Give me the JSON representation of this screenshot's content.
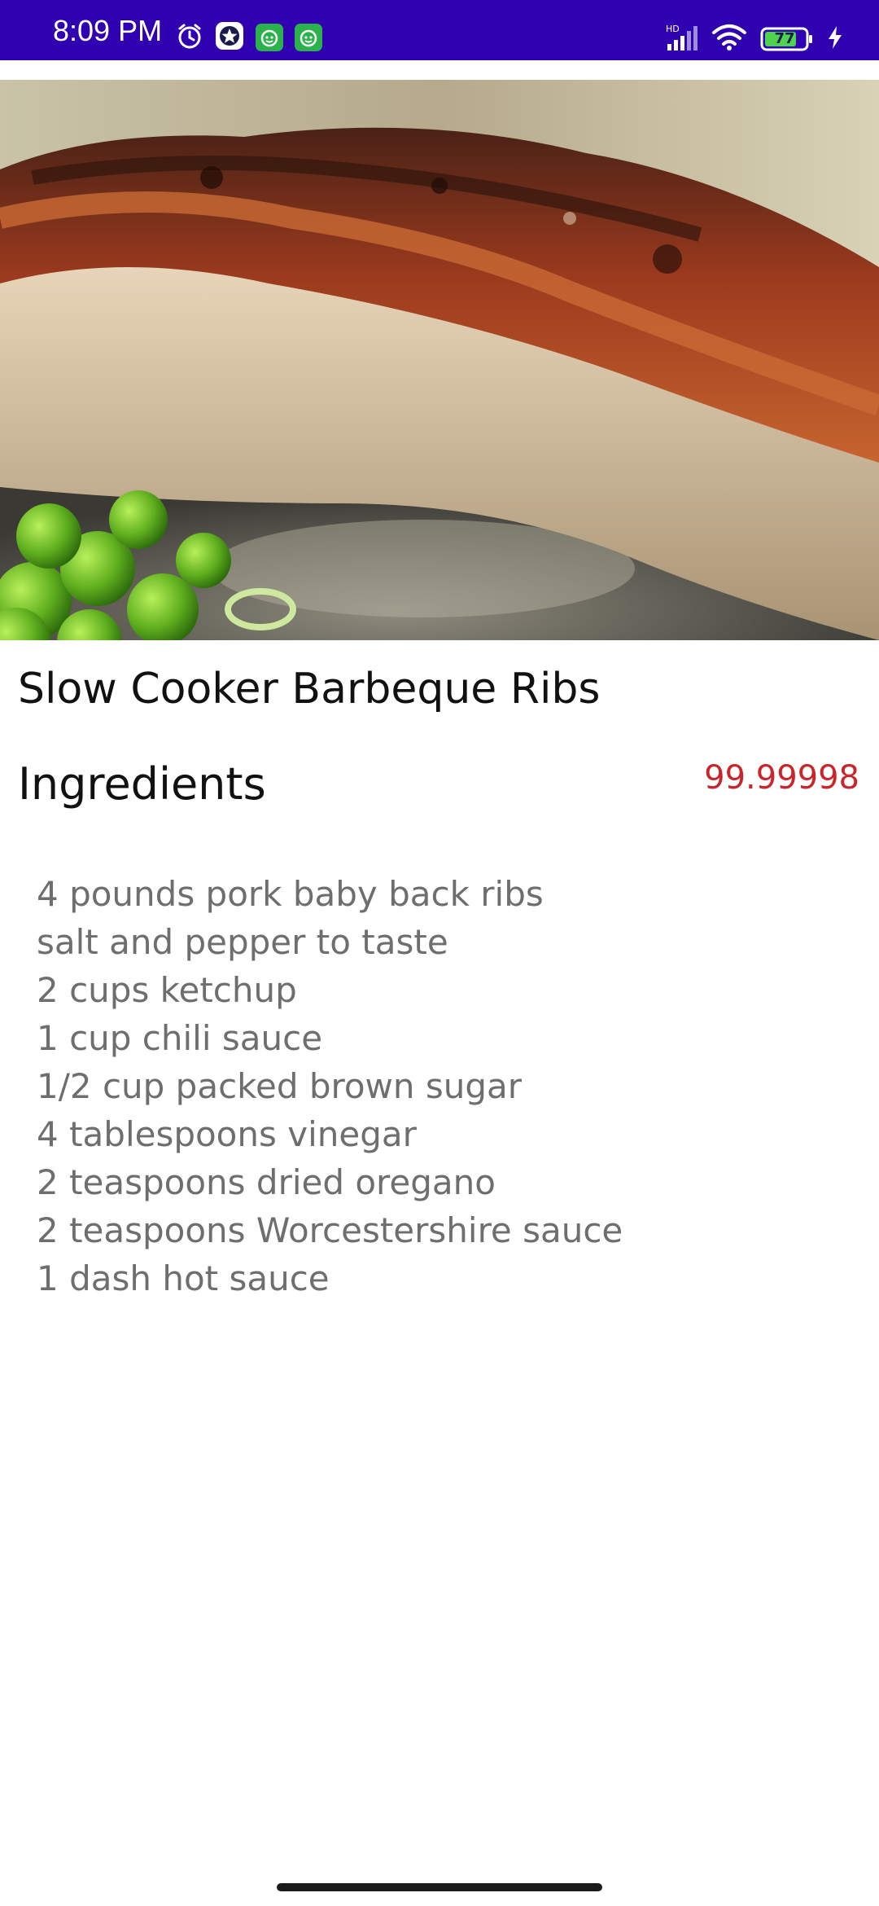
{
  "status_bar": {
    "time": "8:09 PM",
    "battery": "77",
    "network": "HD",
    "colors": {
      "background": "#2f01b0"
    },
    "icons": [
      "alarm-icon",
      "star-app-icon",
      "android-app-icon",
      "android-app-icon",
      "signal-icon",
      "wifi-icon",
      "battery-icon",
      "charging-icon"
    ]
  },
  "hero_image": {
    "icon": "food-photo"
  },
  "recipe": {
    "title": "Slow Cooker Barbeque Ribs",
    "ingredients_heading": "Ingredients",
    "price": "99.99998",
    "ingredients": [
      "4 pounds pork baby back ribs",
      "salt and pepper to taste",
      "2 cups ketchup",
      "1 cup chili sauce",
      "1/2 cup packed brown sugar",
      "4 tablespoons vinegar",
      "2 teaspoons dried oregano",
      "2 teaspoons Worcestershire sauce",
      "1 dash hot sauce"
    ]
  },
  "colors": {
    "price": "#c8262b",
    "text_primary": "#111111",
    "text_secondary": "#6e6e6e"
  }
}
